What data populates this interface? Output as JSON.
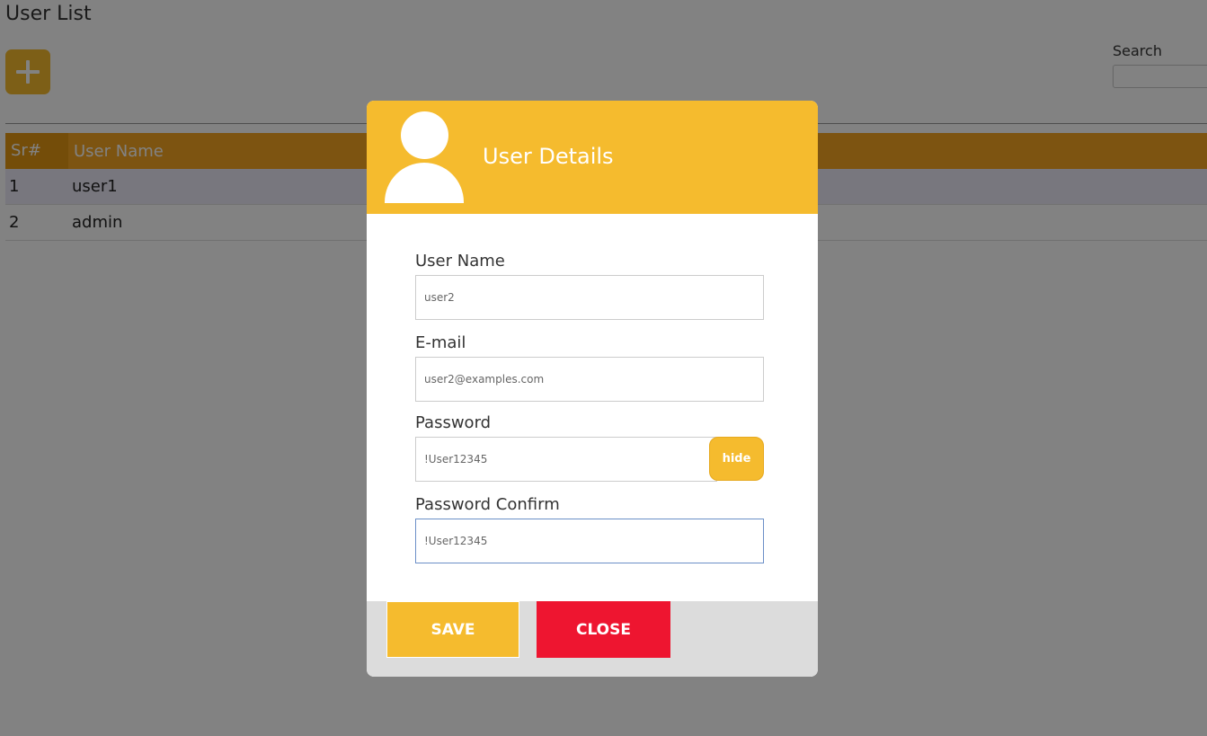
{
  "page": {
    "title": "User List",
    "search_label": "Search",
    "table": {
      "columns": [
        "Sr#",
        "User Name"
      ],
      "rows": [
        {
          "sr": "1",
          "name": "user1"
        },
        {
          "sr": "2",
          "name": "admin"
        }
      ]
    }
  },
  "modal": {
    "title": "User Details",
    "fields": {
      "username": {
        "label": "User Name",
        "value": "user2"
      },
      "email": {
        "label": "E-mail",
        "value": "user2@examples.com"
      },
      "password": {
        "label": "Password",
        "value": "!User12345",
        "toggle_label": "hide"
      },
      "password_confirm": {
        "label": "Password Confirm",
        "value": "!User12345"
      }
    },
    "save_label": "SAVE",
    "close_label": "CLOSE"
  },
  "colors": {
    "accent": "#f5bb2e",
    "danger": "#ee1530",
    "table_header": "#f5a623"
  },
  "icons": {
    "add": "plus-icon",
    "avatar": "user-avatar-icon"
  }
}
